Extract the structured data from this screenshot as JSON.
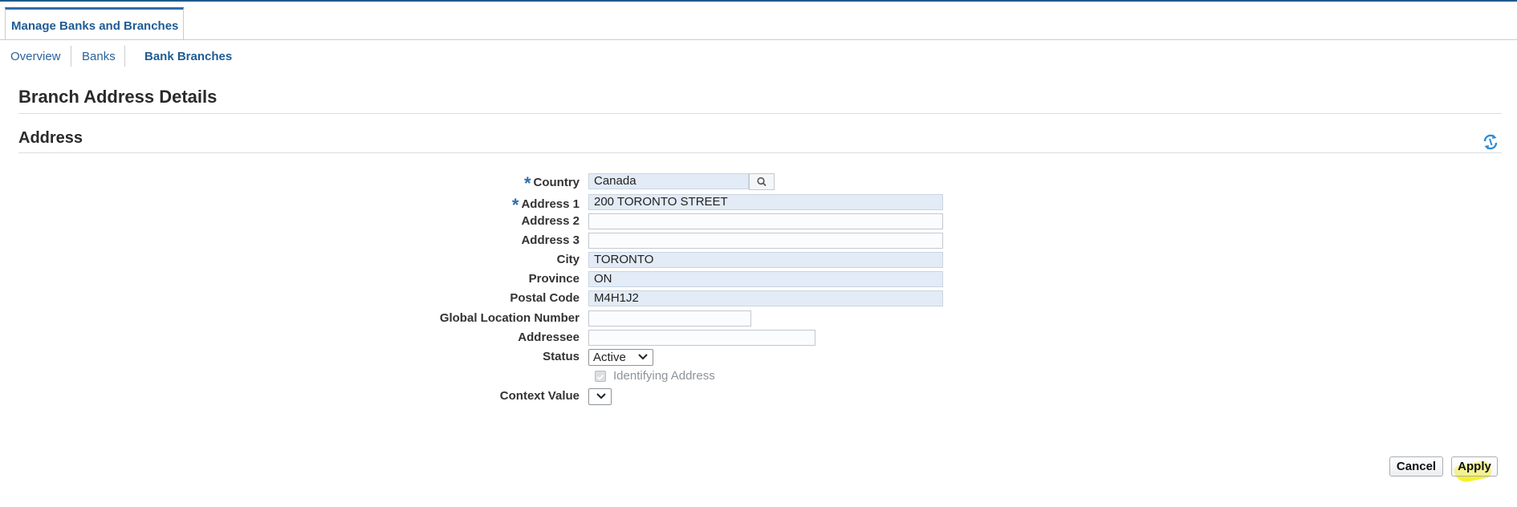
{
  "tabs": [
    {
      "label": "Manage Banks and Branches",
      "active": true
    }
  ],
  "subnav": [
    {
      "label": "Overview"
    },
    {
      "label": "Banks"
    },
    {
      "label": "Bank Branches",
      "active": true
    }
  ],
  "page_title": "Branch Address Details",
  "section_title": "Address",
  "refresh_icon": "refresh-icon",
  "form": {
    "country": {
      "label": "Country",
      "value": "Canada",
      "required": true
    },
    "address1": {
      "label": "Address 1",
      "value": "200 TORONTO STREET",
      "required": true
    },
    "address2": {
      "label": "Address 2",
      "value": ""
    },
    "address3": {
      "label": "Address 3",
      "value": ""
    },
    "city": {
      "label": "City",
      "value": "TORONTO"
    },
    "province": {
      "label": "Province",
      "value": "ON"
    },
    "postal_code": {
      "label": "Postal Code",
      "value": "M4H1J2"
    },
    "gln": {
      "label": "Global Location Number",
      "value": ""
    },
    "addressee": {
      "label": "Addressee",
      "value": ""
    },
    "status": {
      "label": "Status",
      "value": "Active"
    },
    "identifying_address": {
      "label": "Identifying Address",
      "checked": true,
      "disabled": true
    },
    "context_value": {
      "label": "Context Value",
      "value": ""
    }
  },
  "buttons": {
    "cancel": "Cancel",
    "apply": "Apply"
  },
  "colors": {
    "accent": "#1f5c94",
    "filled_field": "#e3ebf6",
    "highlight": "#f4f000"
  }
}
